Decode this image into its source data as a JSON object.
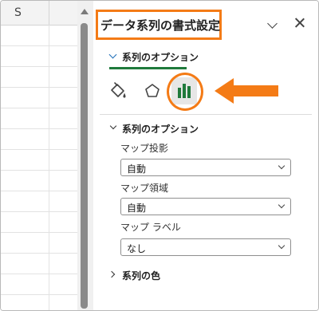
{
  "sheet": {
    "column_label": "S"
  },
  "pane": {
    "title": "データ系列の書式設定",
    "tab": {
      "label": "系列のオプション"
    },
    "icons": [
      "fill-bucket-icon",
      "pentagon-icon",
      "bar-chart-icon"
    ],
    "highlight_color": "#f47b16",
    "accent_color": "#1f7a3c",
    "section": {
      "title": "系列のオプション",
      "fields": [
        {
          "label": "マップ投影",
          "value": "自動"
        },
        {
          "label": "マップ領域",
          "value": "自動"
        },
        {
          "label": "マップ ラベル",
          "value": "なし"
        }
      ]
    },
    "color_section": {
      "title": "系列の色"
    }
  }
}
